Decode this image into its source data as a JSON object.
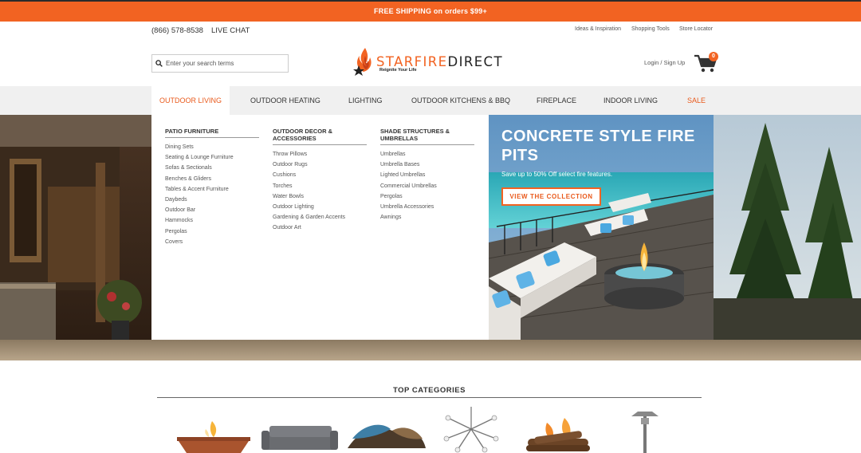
{
  "promo_bar": {
    "text": "FREE SHIPPING on orders $99+"
  },
  "header": {
    "phone": "(866) 578-8538",
    "live_chat": "LIVE CHAT",
    "utility_links": [
      "Ideas & Inspiration",
      "Shopping Tools",
      "Store Locator"
    ],
    "search_placeholder": "Enter your search terms",
    "logo": {
      "star": "STAR",
      "fire": "FIRE",
      "direct": "DIRECT",
      "tagline": "Reignite Your Life"
    },
    "login": "Login / Sign Up",
    "cart_count": "0"
  },
  "nav": {
    "items": [
      "OUTDOOR LIVING",
      "OUTDOOR HEATING",
      "LIGHTING",
      "OUTDOOR KITCHENS & BBQ",
      "FIREPLACE",
      "INDOOR LIVING",
      "SALE"
    ],
    "active": "OUTDOOR LIVING"
  },
  "mega_menu": {
    "columns": [
      {
        "heading": "PATIO FURNITURE",
        "links": [
          "Dining Sets",
          "Seating & Lounge Furniture",
          "Sofas & Sectionals",
          "Benches & Gliders",
          "Tables & Accent Furniture",
          "Daybeds",
          "Outdoor Bar",
          "Hammocks",
          "Pergolas",
          "Covers"
        ]
      },
      {
        "heading_line1": "OUTDOOR DECOR &",
        "heading_line2": "ACCESSORIES",
        "links": [
          "Throw Pillows",
          "Outdoor Rugs",
          "Cushions",
          "Torches",
          "Water Bowls",
          "Outdoor Lighting",
          "Gardening & Garden Accents",
          "Outdoor Art"
        ]
      },
      {
        "heading_line1": "SHADE STRUCTURES &",
        "heading_line2": "UMBRELLAS",
        "links": [
          "Umbrellas",
          "Umbrella Bases",
          "Lighted Umbrellas",
          "Commercial Umbrellas",
          "Pergolas",
          "Umbrella Accessories",
          "Awnings"
        ]
      }
    ],
    "promo": {
      "title": "CONCRETE STYLE FIRE PITS",
      "subtitle": "Save up to 50% Off select fire features.",
      "button": "VIEW THE COLLECTION"
    }
  },
  "top_categories": {
    "title": "TOP CATEGORIES"
  },
  "colors": {
    "accent": "#f26322",
    "accent_text": "#e95a1c",
    "nav_bg": "#f0f0f0",
    "text": "#333333"
  }
}
